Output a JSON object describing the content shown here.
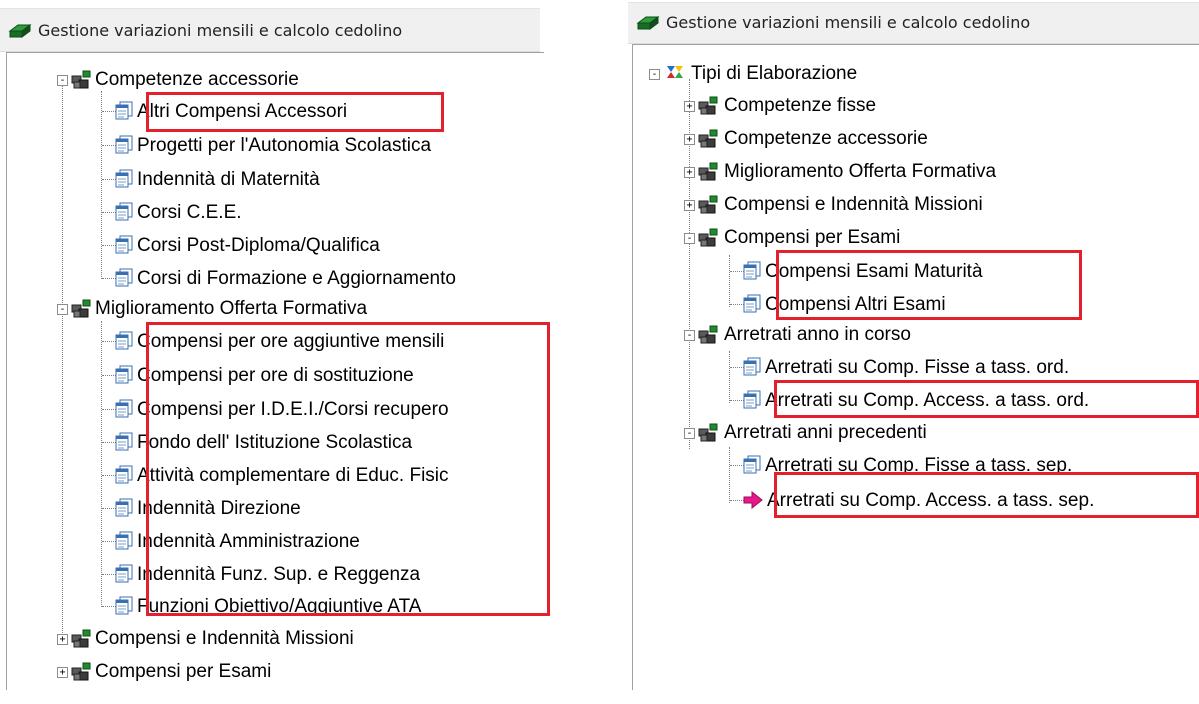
{
  "left": {
    "title": "Gestione variazioni mensili e calcolo cedolino",
    "groups": [
      {
        "label": "Competenze accessorie",
        "state": "-"
      },
      {
        "label": "Miglioramento Offerta Formativa",
        "state": "-"
      },
      {
        "label": "Compensi e Indennità Missioni",
        "state": "+"
      },
      {
        "label": "Compensi per Esami",
        "state": "+"
      }
    ],
    "accessorie_items": [
      "Altri Compensi Accessori",
      "Progetti per l'Autonomia Scolastica",
      "Indennità di Maternità",
      "Corsi C.E.E.",
      "Corsi Post-Diploma/Qualifica",
      "Corsi di Formazione e Aggiornamento"
    ],
    "offerta_items": [
      "Compensi per ore aggiuntive mensili",
      "Compensi per ore di sostituzione",
      "Compensi  per I.D.E.I./Corsi recupero",
      "Fondo dell' Istituzione Scolastica",
      "Attività complementare di Educ. Fisic",
      "Indennità Direzione",
      "Indennità Amministrazione",
      "Indennità Funz. Sup. e Reggenza",
      "Funzioni Obiettivo/Aggiuntive ATA"
    ]
  },
  "right": {
    "title": "Gestione variazioni mensili e calcolo cedolino",
    "root": {
      "label": "Tipi di Elaborazione",
      "state": "-"
    },
    "groups": [
      {
        "label": "Competenze fisse",
        "state": "+"
      },
      {
        "label": "Competenze accessorie",
        "state": "+"
      },
      {
        "label": "Miglioramento Offerta Formativa",
        "state": "+"
      },
      {
        "label": "Compensi e Indennità Missioni",
        "state": "+"
      },
      {
        "label": "Compensi per Esami",
        "state": "-"
      },
      {
        "label": "Arretrati anno in corso",
        "state": "-"
      },
      {
        "label": "Arretrati anni precedenti",
        "state": "-"
      }
    ],
    "esami_items": [
      "Compensi Esami Maturità",
      "Compensi Altri Esami"
    ],
    "anno_items": [
      "Arretrati su Comp. Fisse a tass. ord.",
      "Arretrati  su Comp. Access. a tass. ord."
    ],
    "precedenti_items": [
      "Arretrati  su Comp. Fisse a tass. sep.",
      "Arretrati su Comp. Access. a tass. sep."
    ]
  },
  "colors": {
    "highlight": "#e3202c",
    "arrow": "#e8178a"
  }
}
